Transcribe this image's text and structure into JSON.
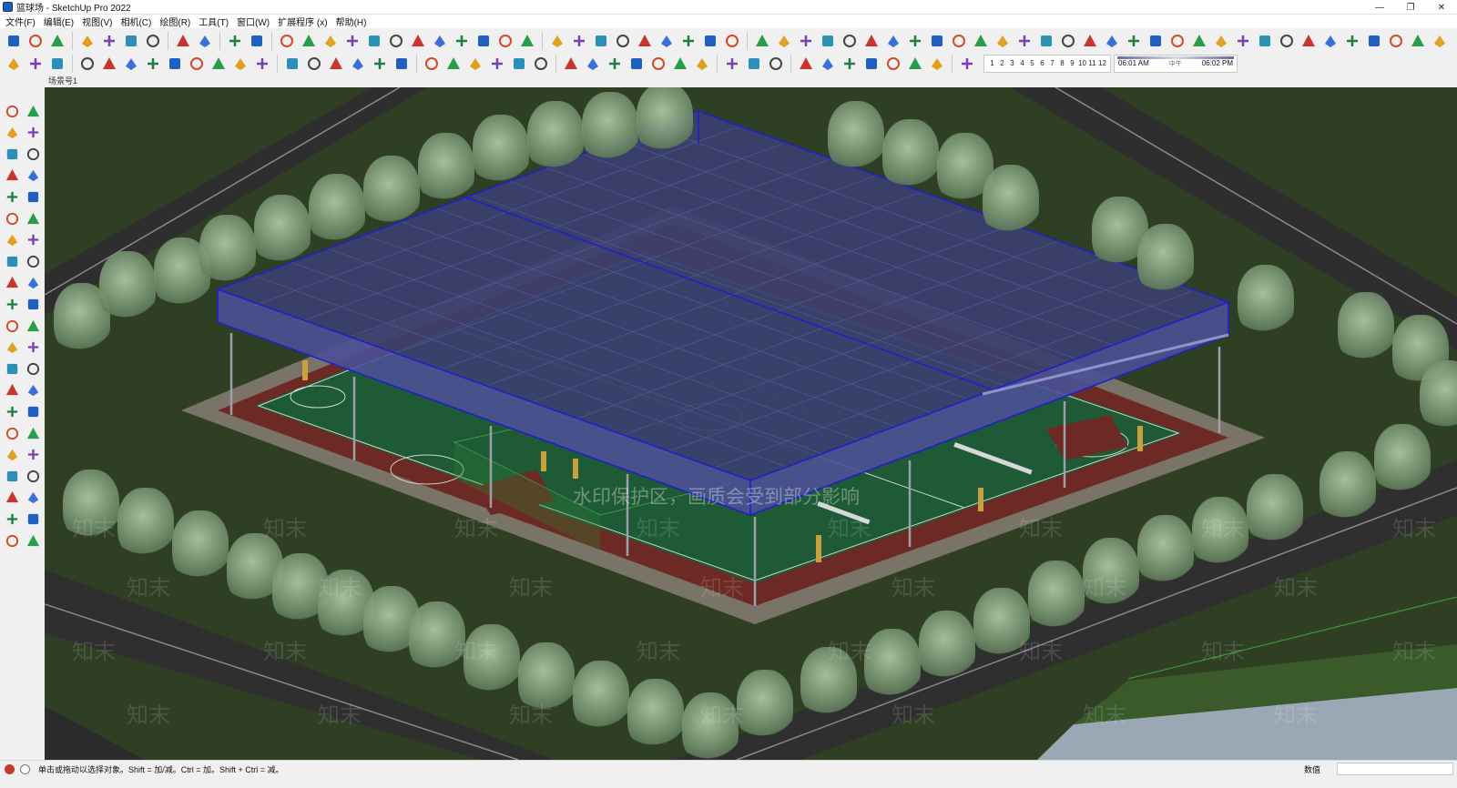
{
  "window": {
    "title": "篮球场 - SketchUp Pro 2022",
    "controls": [
      "—",
      "❐",
      "✕"
    ]
  },
  "menu": [
    "文件(F)",
    "编辑(E)",
    "视图(V)",
    "相机(C)",
    "绘图(R)",
    "工具(T)",
    "窗口(W)",
    "扩展程序 (x)",
    "帮助(H)"
  ],
  "toolbar1_icons": [
    "new-icon",
    "open-icon",
    "save-icon",
    "cut-icon",
    "copy-icon",
    "paste-icon",
    "erase-icon",
    "undo-icon",
    "redo-icon",
    "print-icon",
    "model-info-icon",
    "select-tool-icon",
    "make-component-icon",
    "outer-shell-icon",
    "intersect-icon",
    "follow-me-icon",
    "rectangle-icon",
    "push-pull-icon",
    "offset-icon",
    "section-icon",
    "curve-icon",
    "import-icon",
    "box-icon",
    "material-icon",
    "group-icon",
    "component-icon",
    "extension-a-icon",
    "extension-b-icon",
    "extension-c-icon",
    "layer-icon",
    "blue-box-icon",
    "axes-f-icon",
    "axes-n-icon",
    "axes-j-icon",
    "axes-v-icon",
    "arrow-up-icon",
    "shield-icon",
    "sandbox-icon",
    "arc-icon",
    "grid-icon",
    "palette-icon",
    "gem-icon",
    "spline-icon",
    "cylinder-icon",
    "tube-icon",
    "mirror-icon",
    "align-icon",
    "terrain-icon",
    "camera-icon",
    "3d-icon",
    "diamond-a-icon",
    "diamond-b-icon",
    "cloud-a-icon",
    "cloud-b-icon",
    "cloud-c-icon",
    "cloud-d-icon",
    "frame-icon",
    "settings-a-icon",
    "check-icon",
    "download-icon",
    "cog-icon",
    "gear-icon",
    "cube-icon",
    "chrome-icon"
  ],
  "toolbar2_icons": [
    "warehouse-icon",
    "refresh-icon",
    "layers-stack-icon",
    "add-location-icon",
    "tree-icon",
    "landscape-icon",
    "checker-icon",
    "cloud-upload-icon",
    "gear-cluster-icon",
    "mail-icon",
    "info-icon",
    "person-icon",
    "walk-icon",
    "look-around-icon",
    "pan-icon",
    "ruler-icon",
    "figure-icon",
    "orbit-view-icon",
    "iso-view-icon",
    "top-view-icon",
    "front-view-icon",
    "right-view-icon",
    "back-view-icon",
    "left-view-icon",
    "xray-icon",
    "back-edges-icon",
    "wireframe-icon",
    "hidden-line-icon",
    "shaded-icon",
    "shaded-texture-icon",
    "monochrome-icon",
    "scenes-a-icon",
    "scenes-b-icon",
    "scenes-c-icon",
    "layer-stack-a-icon",
    "layer-stack-b-icon",
    "minus-circle-icon",
    "check-circle-icon",
    "lock-icon",
    "unlock-icon",
    "eye-icon",
    "shadow-toggle-icon"
  ],
  "shadow": {
    "months": [
      "1",
      "2",
      "3",
      "4",
      "5",
      "6",
      "7",
      "8",
      "9",
      "10",
      "11",
      "12"
    ],
    "time_start": "06:01 AM",
    "time_mid": "中午",
    "time_end": "06:02 PM"
  },
  "scene_tab": "场景号1",
  "left_tools": [
    "select-icon",
    "orbit-icon",
    "paint-bucket-icon",
    "eraser-icon",
    "component-icon",
    "tape-icon",
    "pencil-icon",
    "freehand-icon",
    "rectangle-icon",
    "rotated-rectangle-icon",
    "circle-icon",
    "polygon-icon",
    "arc-icon",
    "two-point-arc-icon",
    "pie-icon",
    "three-point-arc-icon",
    "move-icon",
    "push-pull-icon",
    "rotate-icon",
    "follow-me-icon",
    "scale-icon",
    "offset-icon",
    "tape-measure-icon",
    "dimension-icon",
    "protractor-icon",
    "text-icon",
    "axes-icon",
    "3d-text-icon",
    "orbit-tool-icon",
    "pan-tool-icon",
    "zoom-icon",
    "zoom-window-icon",
    "zoom-extents-icon",
    "previous-view-icon",
    "position-camera-icon",
    "look-around-tool-icon",
    "walk-tool-icon",
    "section-plane-icon",
    "sandbox-from-contours-icon",
    "sandbox-from-scratch-icon",
    "smoove-icon",
    "stamp-icon"
  ],
  "watermarks": {
    "banner": "水印保护区，画质会受到部分影响",
    "text": "知末"
  },
  "status": {
    "hint": "单击或拖动以选择对象。Shift = 加/减。Ctrl = 加。Shift + Ctrl = 减。",
    "measurements_label": "数值"
  }
}
